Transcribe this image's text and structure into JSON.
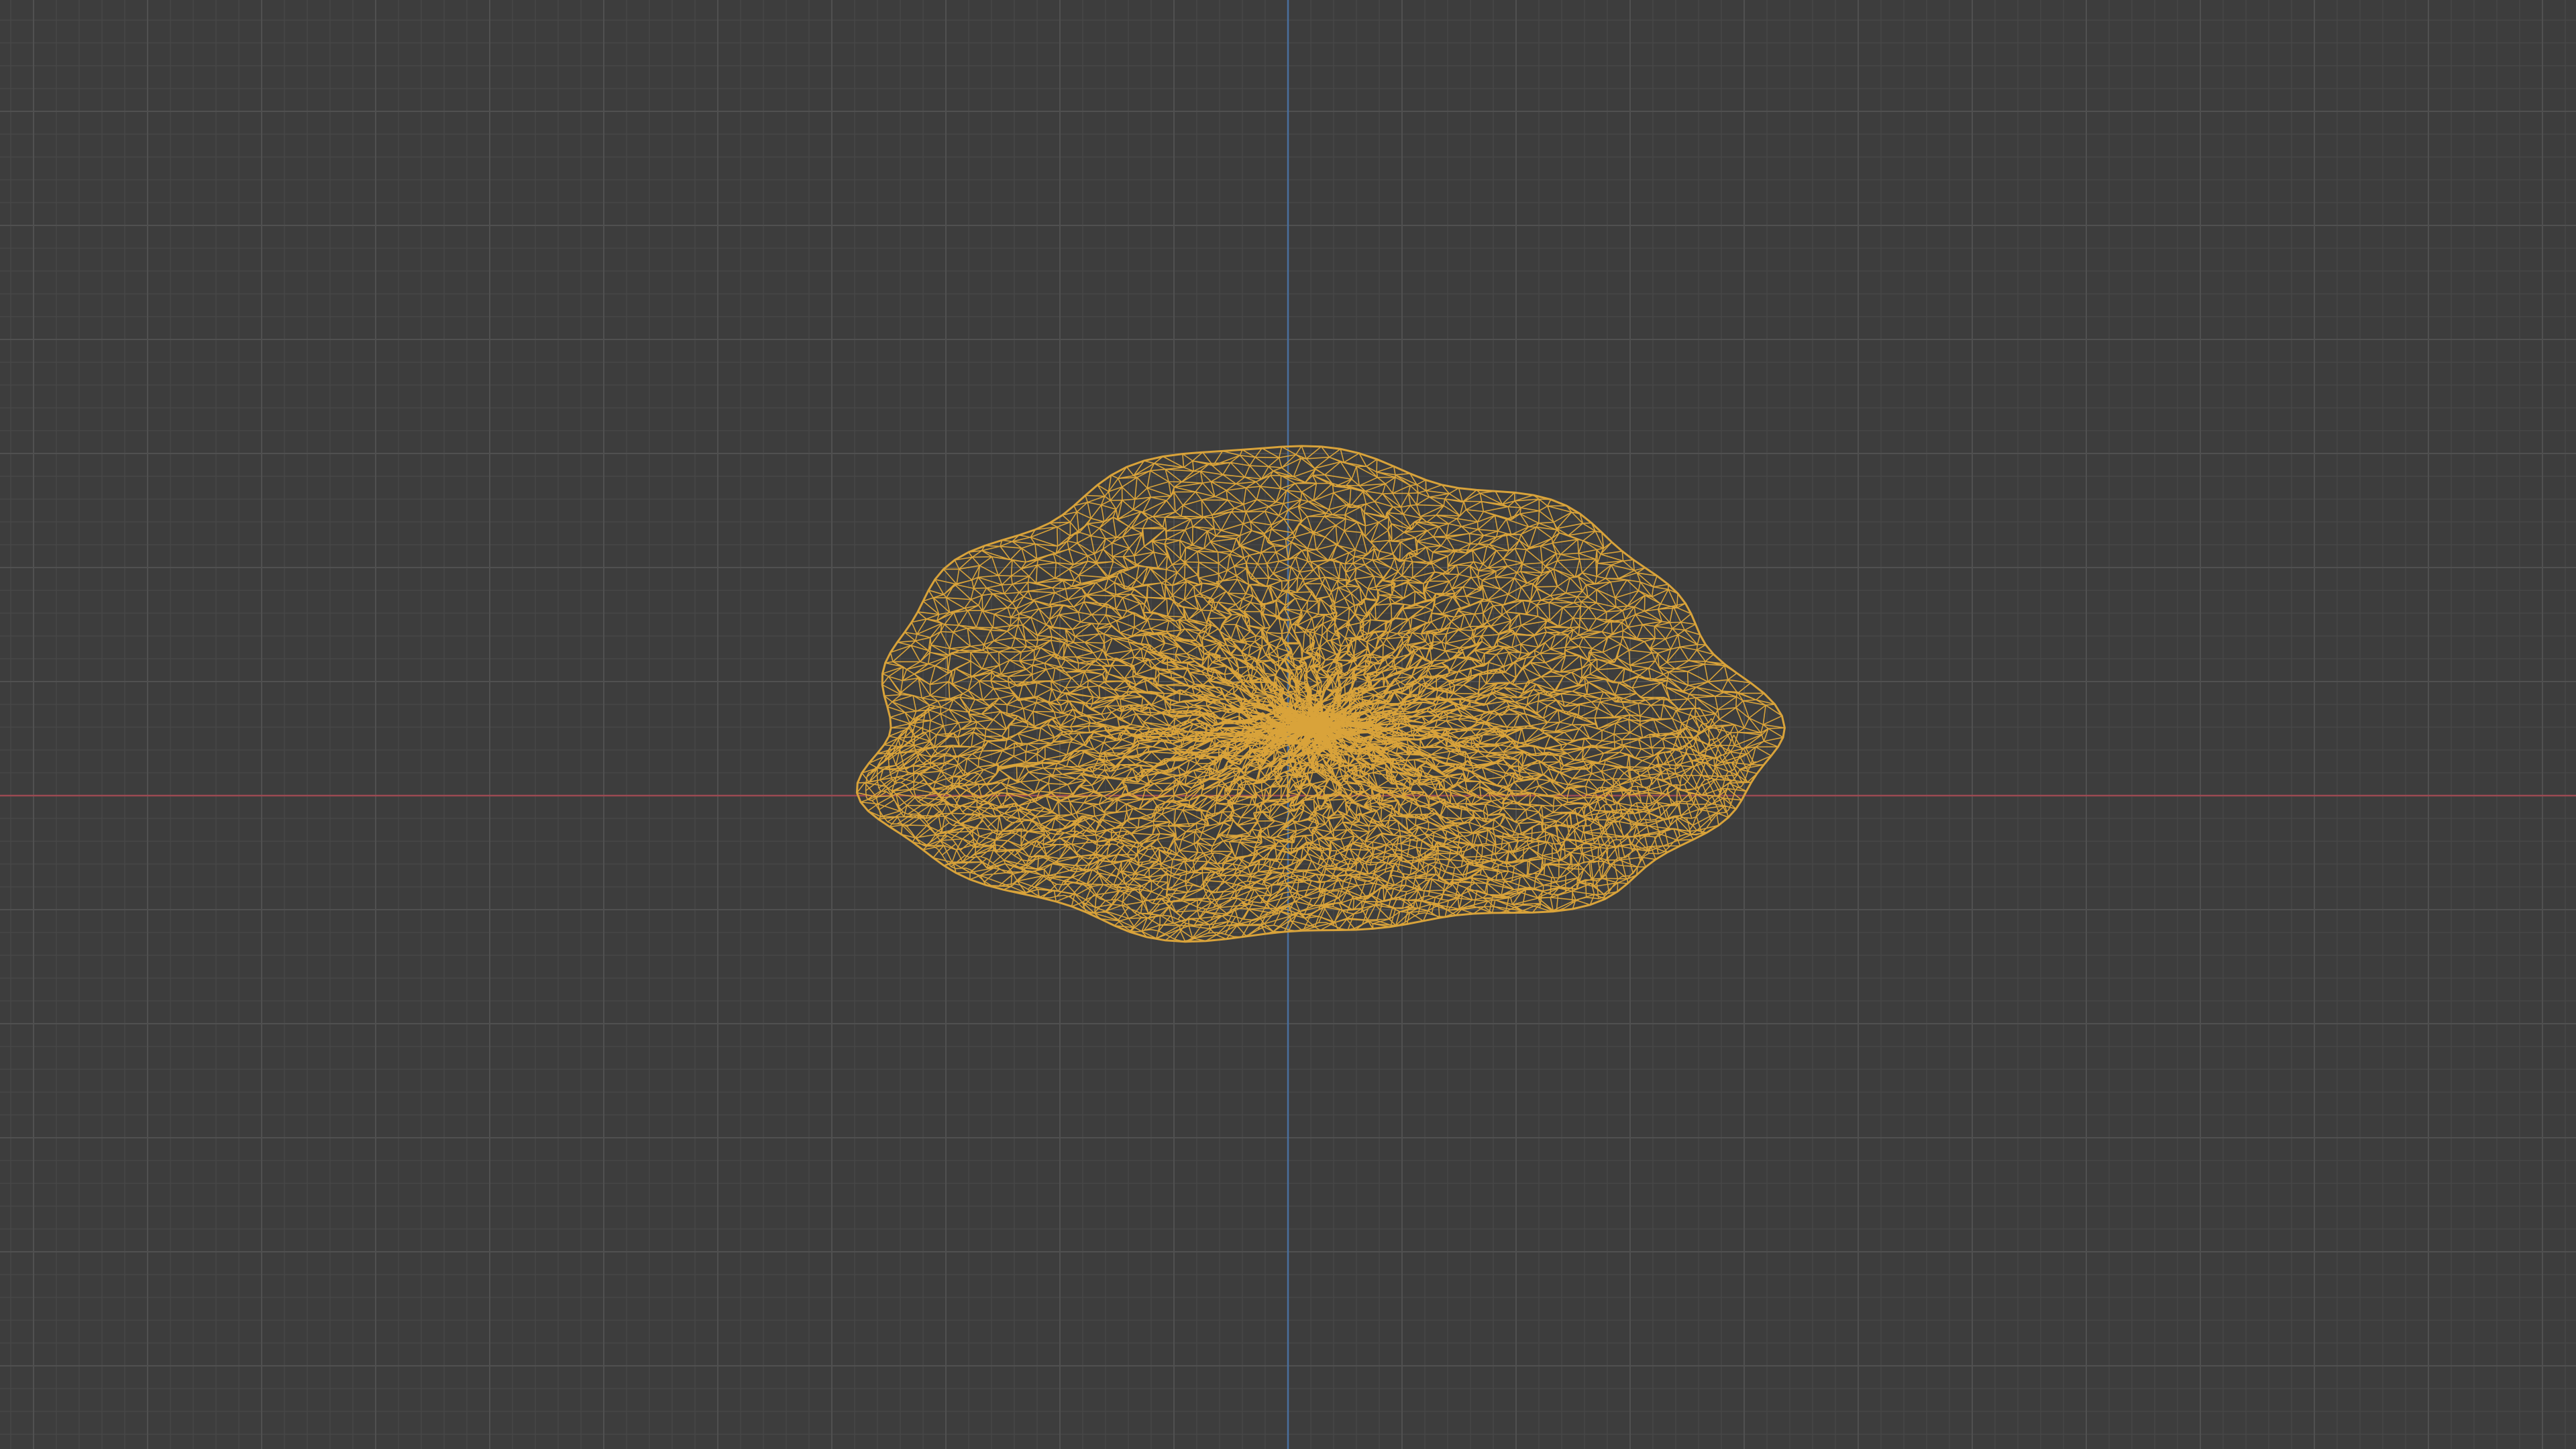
{
  "viewport": {
    "background_color": "#3d3d3d",
    "minor_grid_color": "#474747",
    "major_grid_color": "#505050",
    "x_axis_color": "#9b4a52",
    "y_axis_color": "#4a6f9e",
    "grid_visible": true
  },
  "mesh": {
    "display_mode": "wireframe",
    "selected": true,
    "wire_color": "#d9a33a",
    "origin_marker": true
  }
}
